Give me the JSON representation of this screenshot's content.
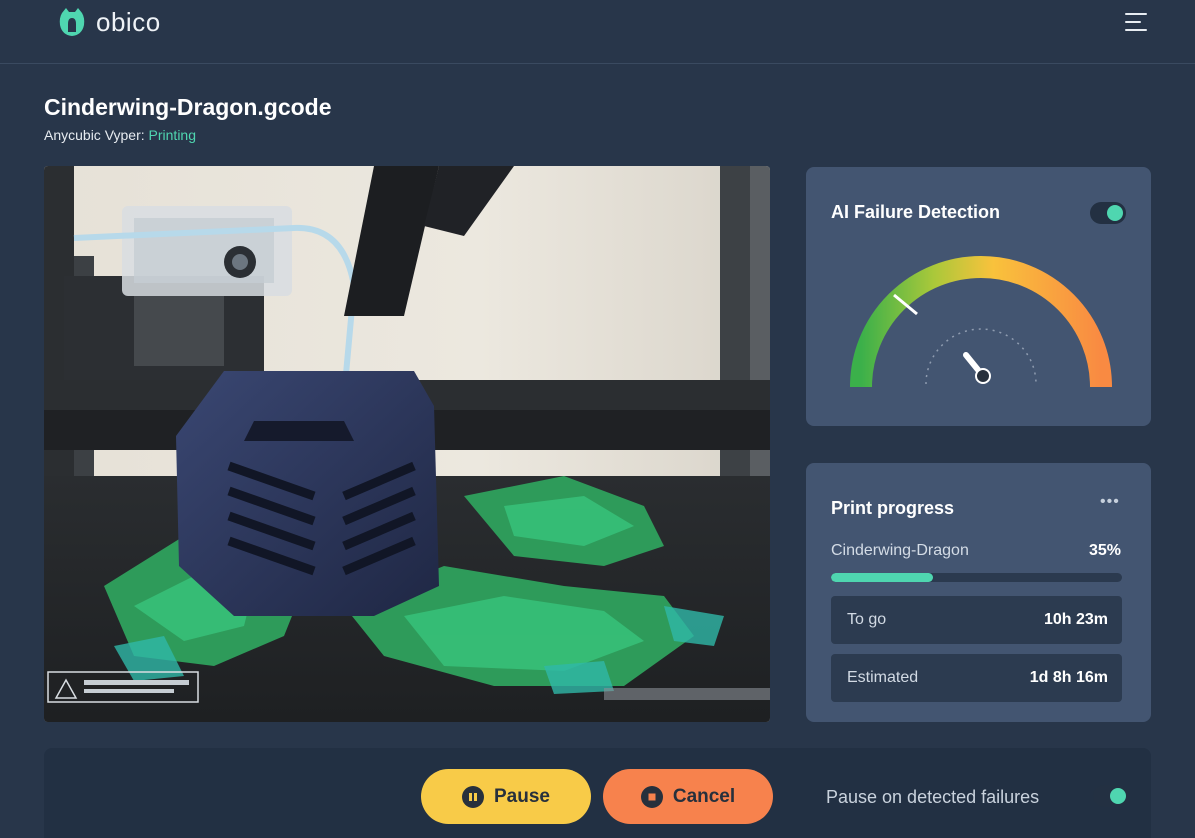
{
  "header": {
    "logo_text": "obico",
    "menu_icon": "hamburger-menu-icon"
  },
  "print": {
    "file_name": "Cinderwing-Dragon.gcode",
    "printer_name": "Anycubic Vyper:",
    "status": "Printing",
    "status_color": "#4fd6b0"
  },
  "ai_detection": {
    "title": "AI Failure Detection",
    "enabled": true,
    "gauge_level": 0.15
  },
  "progress": {
    "title": "Print progress",
    "more_icon": "more-dots-icon",
    "job_name": "Cinderwing-Dragon",
    "percent_label": "35%",
    "percent": 0.35,
    "to_go_label": "To go",
    "to_go_value": "10h 23m",
    "estimated_label": "Estimated",
    "estimated_value": "1d 8h 16m"
  },
  "controls": {
    "pause_label": "Pause",
    "cancel_label": "Cancel",
    "pause_on_failures_label": "Pause on detected failures",
    "pause_on_failures_enabled": true
  },
  "colors": {
    "accent": "#4fd6b0",
    "pause": "#f8cb48",
    "cancel": "#f7824d",
    "background": "#28364a",
    "card": "#435571"
  }
}
